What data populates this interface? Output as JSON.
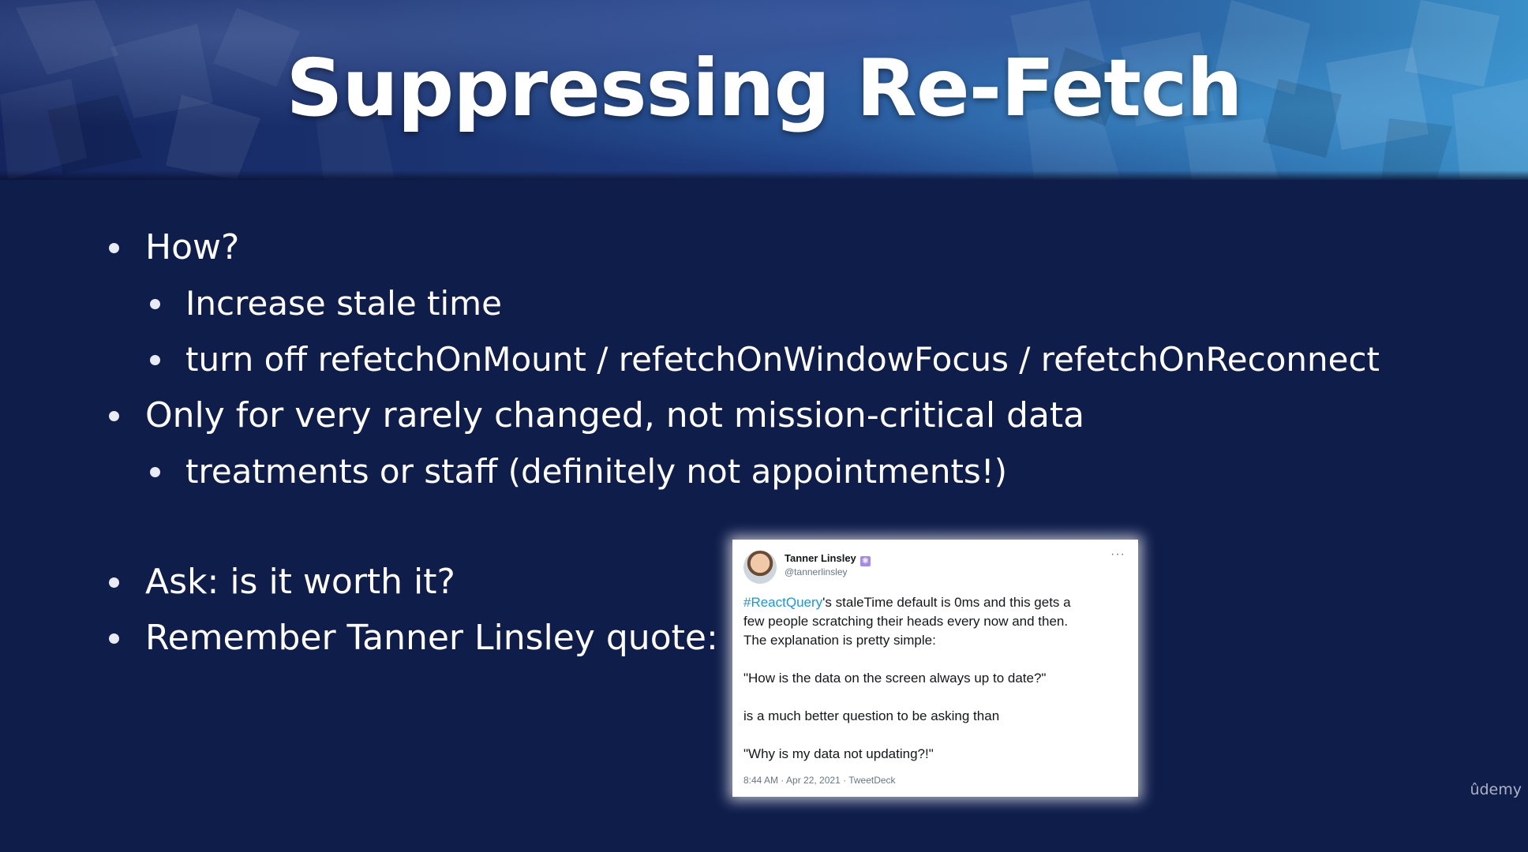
{
  "slide": {
    "title": "Suppressing Re-Fetch",
    "bullets": [
      {
        "text": "How?"
      },
      {
        "text": "Increase stale time"
      },
      {
        "text": "turn off refetchOnMount / refetchOnWindowFocus / refetchOnReconnect"
      },
      {
        "text": "Only for very rarely changed, not mission-critical data"
      },
      {
        "text": "treatments or staff (definitely not appointments!)"
      },
      {
        "text": "Ask: is it worth it?"
      },
      {
        "text": "Remember Tanner Linsley quote:"
      }
    ]
  },
  "tweet": {
    "author_name": "Tanner Linsley",
    "verified_badge": "⚛",
    "handle": "@tannerlinsley",
    "more_label": "···",
    "hashtag": "#ReactQuery",
    "line1_rest": "'s staleTime default is 0ms and this gets a",
    "line2": "few people scratching their heads every now and then.",
    "line3": "The explanation is pretty simple:",
    "quote1": "\"How is the data on the screen always up to date?\"",
    "quote2": "is a much better question to be asking than",
    "quote3": "\"Why is my data not updating?!\"",
    "meta": "8:44 AM · Apr 22, 2021 · TweetDeck"
  },
  "watermark": {
    "text": "ûdemy"
  }
}
